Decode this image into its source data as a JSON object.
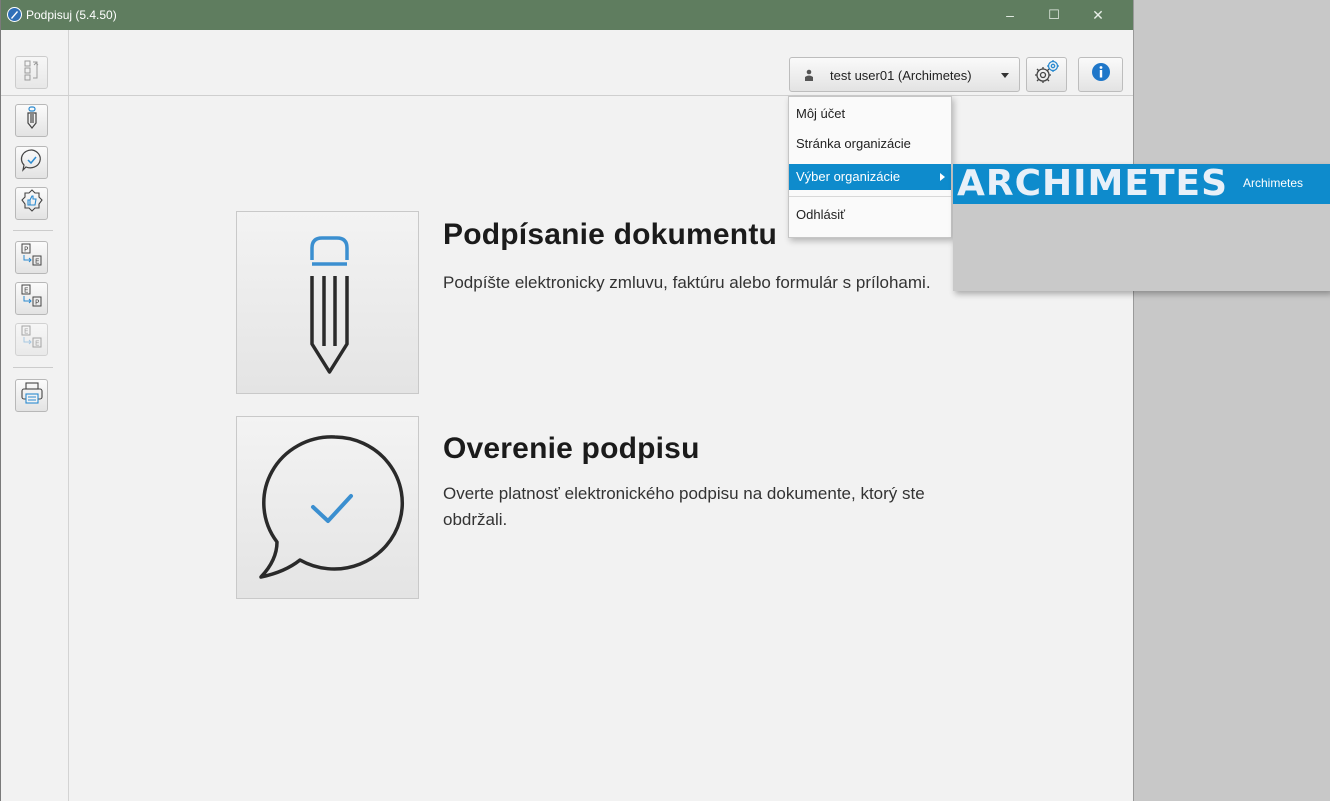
{
  "window": {
    "title": "Podpisuj (5.4.50)",
    "controls": {
      "minimize": "–",
      "maximize": "☐",
      "close": "✕"
    }
  },
  "toolbar": {
    "user_label": "test user01 (Archimetes)",
    "settings_icon": "gear-icon",
    "info_icon": "info-icon"
  },
  "sidebar": {
    "items": [
      {
        "icon": "pen-icon"
      },
      {
        "icon": "speech-bubble-check-icon"
      },
      {
        "icon": "badge-thumbs-up-icon"
      },
      {
        "icon": "convert-p-to-e-icon"
      },
      {
        "icon": "convert-e-to-p-icon"
      },
      {
        "icon": "convert-e-to-e-icon",
        "disabled": true
      },
      {
        "icon": "printer-icon"
      }
    ]
  },
  "main": {
    "cards": [
      {
        "title": "Podpísanie dokumentu",
        "description": "Podpíšte elektronicky zmluvu, faktúru alebo formulár s prílohami."
      },
      {
        "title": "Overenie podpisu",
        "description": "Overte platnosť elektronického podpisu na dokumente, ktorý ste obdržali."
      }
    ]
  },
  "user_menu": {
    "items": [
      {
        "label": "Môj účet"
      },
      {
        "label": "Stránka organizácie"
      },
      {
        "label": "Výber organizácie",
        "selected": true,
        "has_submenu": true
      },
      {
        "label": "Odhlásiť"
      }
    ],
    "submenu": {
      "logo_text": "ARCHIMETES",
      "org_name": "Archimetes"
    }
  },
  "colors": {
    "titlebar": "#5f7d5f",
    "accent": "#0e8bcc",
    "icon_blue": "#3b8fd0"
  }
}
